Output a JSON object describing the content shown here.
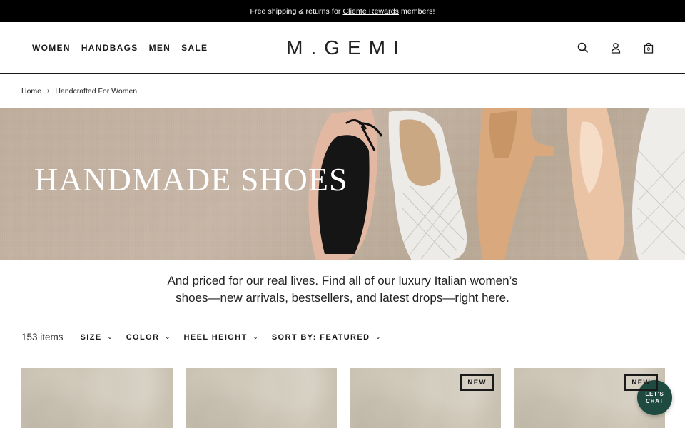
{
  "promo": {
    "text_before": "Free shipping & returns for",
    "link": "Cliente Rewards",
    "text_after": "members!"
  },
  "nav": {
    "items": [
      "WOMEN",
      "HANDBAGS",
      "MEN",
      "SALE"
    ]
  },
  "logo": "M.GEMI",
  "header_icons": {
    "search": "search-icon",
    "account": "user-icon",
    "bag": "shopping-bag-icon",
    "bag_count": "0"
  },
  "breadcrumb": {
    "home": "Home",
    "current": "Handcrafted For Women"
  },
  "hero": {
    "title": "HANDMADE SHOES"
  },
  "intro": {
    "line1": "And priced for our real lives. Find all of our luxury Italian women’s",
    "line2": "shoes—new arrivals, bestsellers, and latest drops—right here."
  },
  "filters": {
    "count": "153 items",
    "size": "SIZE",
    "color": "COLOR",
    "heel_height": "HEEL HEIGHT",
    "sort": "SORT BY: FEATURED"
  },
  "products": [
    {
      "badge": ""
    },
    {
      "badge": ""
    },
    {
      "badge": "NEW"
    },
    {
      "badge": "NEW"
    }
  ],
  "chat": {
    "line1": "LET'S",
    "line2": "CHAT"
  }
}
